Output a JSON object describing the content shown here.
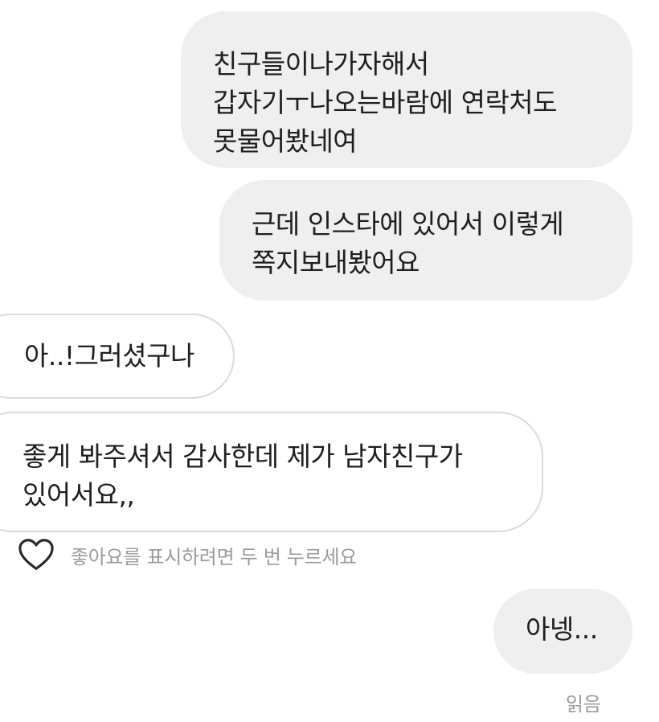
{
  "messages": [
    {
      "direction": "outgoing",
      "text": "친구들이나가자해서\n갑자기ㅜ나오는바람에 연락처도\n못물어봤네여"
    },
    {
      "direction": "outgoing",
      "text": "근데 인스타에 있어서 이렇게\n쪽지보내봤어요"
    },
    {
      "direction": "incoming",
      "text": "아..!그러셨구나"
    },
    {
      "direction": "incoming",
      "text": "좋게 봐주셔서 감사한데 제가 남자친구가\n있어서요,,",
      "liked_hint": "좋아요를 표시하려면 두 번 누르세요"
    },
    {
      "direction": "outgoing",
      "text": "아넹..."
    }
  ],
  "like_hint": "좋아요를 표시하려면 두 번 누르세요",
  "read_status": "읽음",
  "colors": {
    "outgoing_bubble": "#efefef",
    "incoming_border": "#dbdbdb",
    "secondary_text": "#9a9a9a"
  },
  "icons": {
    "like": "heart-outline-icon"
  }
}
